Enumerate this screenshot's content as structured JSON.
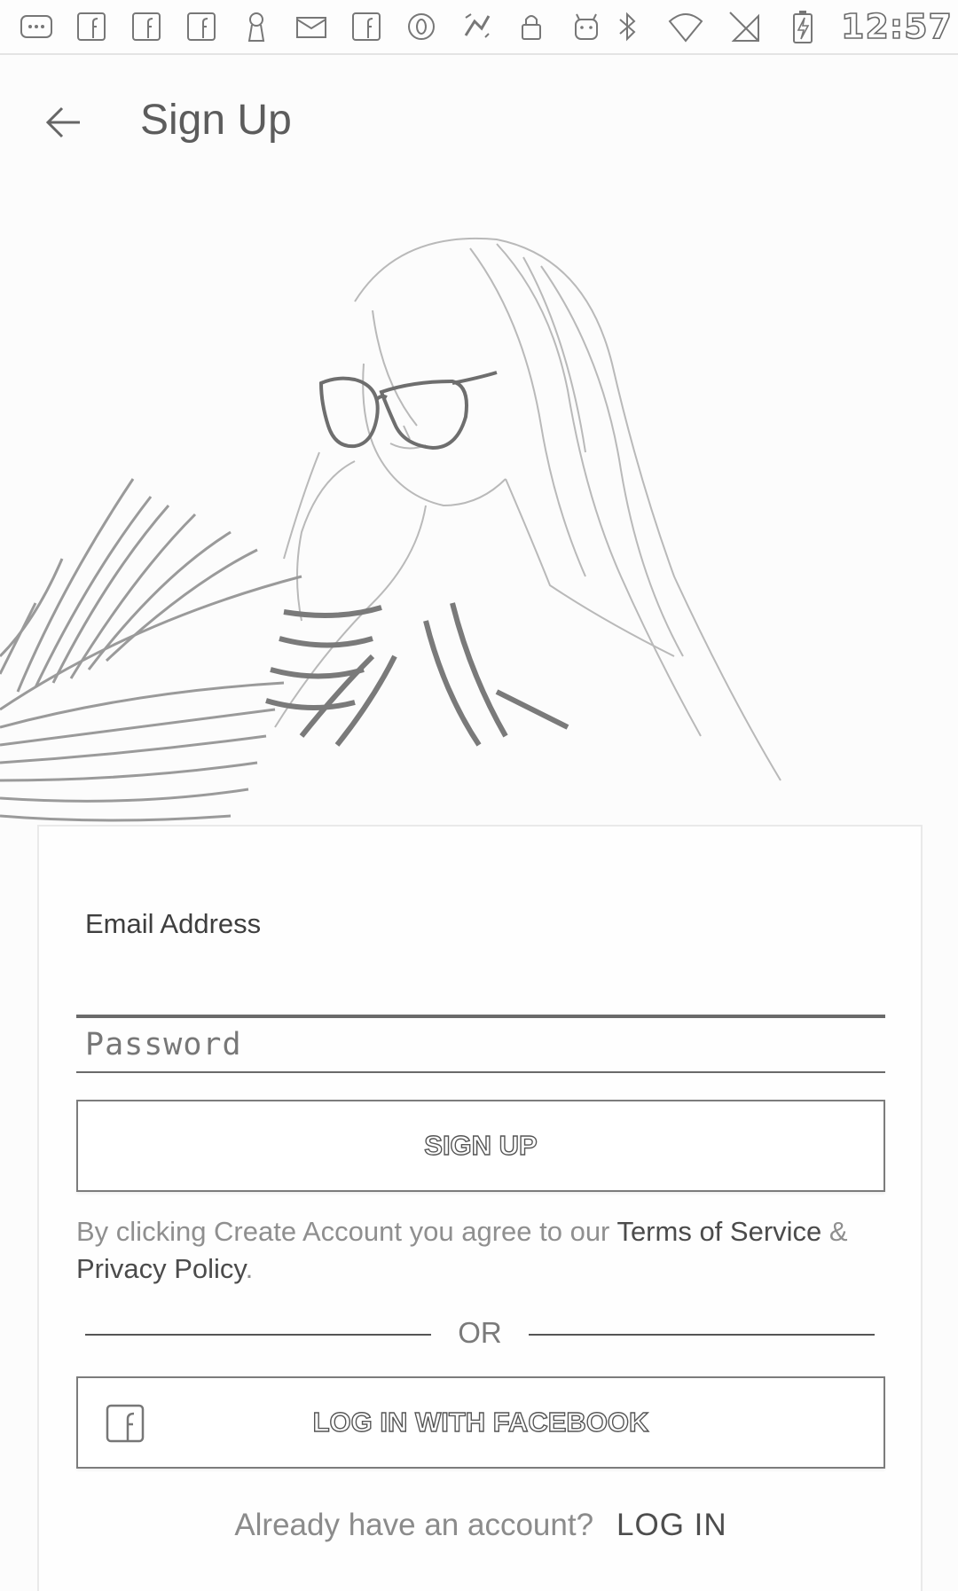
{
  "status_bar": {
    "time": "12:57",
    "left_icons": [
      "more-notifications-icon",
      "facebook-notification-icon",
      "facebook-notification-icon",
      "facebook-notification-icon",
      "keyhole-icon",
      "mail-icon",
      "facebook-notification-icon",
      "circle-o-icon",
      "sync-icon",
      "lock-icon",
      "android-icon"
    ],
    "right_icons": [
      "bluetooth-icon",
      "wifi-icon",
      "no-sim-icon",
      "battery-charging-icon"
    ]
  },
  "header": {
    "title": "Sign Up",
    "back_icon": "arrow-back-icon"
  },
  "form": {
    "email_value": "Email Address",
    "password_placeholder": "Password",
    "signup_label": "SIGN UP",
    "terms_prefix": "By clicking Create Account you agree to our ",
    "terms_link": "Terms of Service",
    "terms_amp": " & ",
    "privacy_link": "Privacy Policy",
    "terms_suffix": ".",
    "or_label": "OR",
    "facebook_label": "LOG IN WITH FACEBOOK",
    "facebook_icon": "facebook-icon",
    "already_text": "Already have an account?",
    "login_label": "LOG IN"
  },
  "colors": {
    "background": "#fcfcfc",
    "text": "#4a4a4a",
    "muted": "#8f8f8f",
    "line": "#6a6a6a"
  }
}
